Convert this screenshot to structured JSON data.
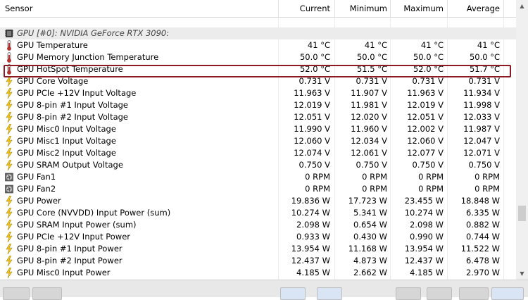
{
  "columns": {
    "sensor": "Sensor",
    "current": "Current",
    "minimum": "Minimum",
    "maximum": "Maximum",
    "average": "Average"
  },
  "group_title": "GPU [#0]: NVIDIA GeForce RTX 3090:",
  "rows": [
    {
      "icon": "thermometer-icon",
      "name": "GPU Temperature",
      "current": "41 °C",
      "minimum": "41 °C",
      "maximum": "41 °C",
      "average": "41 °C"
    },
    {
      "icon": "thermometer-icon",
      "name": "GPU Memory Junction Temperature",
      "current": "50.0 °C",
      "minimum": "50.0 °C",
      "maximum": "50.0 °C",
      "average": "50.0 °C"
    },
    {
      "icon": "thermometer-icon",
      "name": "GPU HotSpot Temperature",
      "current": "52.0 °C",
      "minimum": "51.5 °C",
      "maximum": "52.0 °C",
      "average": "51.7 °C"
    },
    {
      "icon": "lightning-icon",
      "name": "GPU Core Voltage",
      "current": "0.731 V",
      "minimum": "0.731 V",
      "maximum": "0.731 V",
      "average": "0.731 V"
    },
    {
      "icon": "lightning-icon",
      "name": "GPU PCIe +12V Input Voltage",
      "current": "11.963 V",
      "minimum": "11.907 V",
      "maximum": "11.963 V",
      "average": "11.934 V"
    },
    {
      "icon": "lightning-icon",
      "name": "GPU 8-pin #1 Input Voltage",
      "current": "12.019 V",
      "minimum": "11.981 V",
      "maximum": "12.019 V",
      "average": "11.998 V"
    },
    {
      "icon": "lightning-icon",
      "name": "GPU 8-pin #2 Input Voltage",
      "current": "12.051 V",
      "minimum": "12.020 V",
      "maximum": "12.051 V",
      "average": "12.033 V"
    },
    {
      "icon": "lightning-icon",
      "name": "GPU Misc0 Input Voltage",
      "current": "11.990 V",
      "minimum": "11.960 V",
      "maximum": "12.002 V",
      "average": "11.987 V"
    },
    {
      "icon": "lightning-icon",
      "name": "GPU Misc1 Input Voltage",
      "current": "12.060 V",
      "minimum": "12.034 V",
      "maximum": "12.060 V",
      "average": "12.047 V"
    },
    {
      "icon": "lightning-icon",
      "name": "GPU Misc2 Input Voltage",
      "current": "12.074 V",
      "minimum": "12.061 V",
      "maximum": "12.077 V",
      "average": "12.071 V"
    },
    {
      "icon": "lightning-icon",
      "name": "GPU SRAM Output Voltage",
      "current": "0.750 V",
      "minimum": "0.750 V",
      "maximum": "0.750 V",
      "average": "0.750 V"
    },
    {
      "icon": "fan-icon",
      "name": "GPU Fan1",
      "current": "0 RPM",
      "minimum": "0 RPM",
      "maximum": "0 RPM",
      "average": "0 RPM"
    },
    {
      "icon": "fan-icon",
      "name": "GPU Fan2",
      "current": "0 RPM",
      "minimum": "0 RPM",
      "maximum": "0 RPM",
      "average": "0 RPM"
    },
    {
      "icon": "lightning-icon",
      "name": "GPU Power",
      "current": "19.836 W",
      "minimum": "17.723 W",
      "maximum": "23.455 W",
      "average": "18.848 W"
    },
    {
      "icon": "lightning-icon",
      "name": "GPU Core (NVVDD) Input Power (sum)",
      "current": "10.274 W",
      "minimum": "5.341 W",
      "maximum": "10.274 W",
      "average": "6.335 W"
    },
    {
      "icon": "lightning-icon",
      "name": "GPU SRAM Input Power (sum)",
      "current": "2.098 W",
      "minimum": "0.654 W",
      "maximum": "2.098 W",
      "average": "0.882 W"
    },
    {
      "icon": "lightning-icon",
      "name": "GPU PCIe +12V Input Power",
      "current": "0.933 W",
      "minimum": "0.430 W",
      "maximum": "0.990 W",
      "average": "0.744 W"
    },
    {
      "icon": "lightning-icon",
      "name": "GPU 8-pin #1 Input Power",
      "current": "13.954 W",
      "minimum": "11.168 W",
      "maximum": "13.954 W",
      "average": "11.522 W"
    },
    {
      "icon": "lightning-icon",
      "name": "GPU 8-pin #2 Input Power",
      "current": "12.437 W",
      "minimum": "4.873 W",
      "maximum": "12.437 W",
      "average": "6.478 W"
    },
    {
      "icon": "lightning-icon",
      "name": "GPU Misc0 Input Power",
      "current": "4.185 W",
      "minimum": "2.662 W",
      "maximum": "4.185 W",
      "average": "2.970 W"
    }
  ],
  "highlight_color": "#8b1a24",
  "scrollbar": {
    "up_icon": "scroll-up-icon",
    "down_icon": "scroll-down-icon"
  }
}
